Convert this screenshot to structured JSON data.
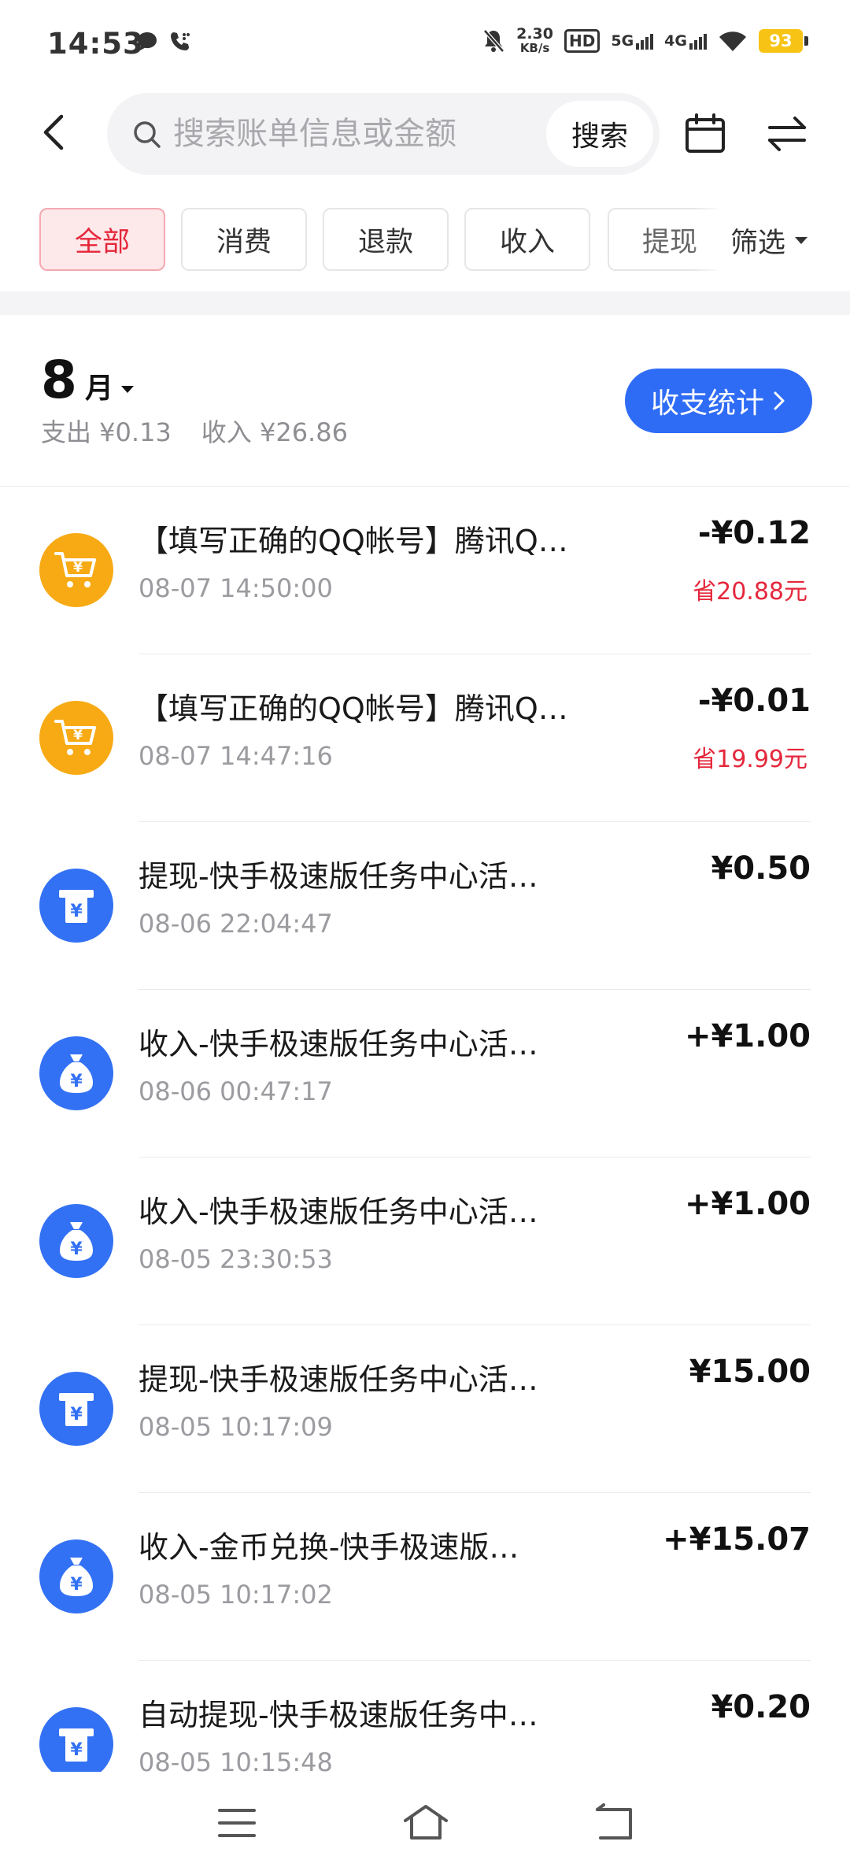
{
  "status_bar": {
    "time": "14:53",
    "speed_value": "2.30",
    "speed_unit": "KB/s",
    "hd_label": "HD",
    "net_5g": "5G",
    "net_4g": "4G",
    "battery": "93",
    "battery_color": "#f7c315"
  },
  "header": {
    "search_placeholder": "搜索账单信息或金额",
    "search_button": "搜索"
  },
  "filters": {
    "tabs": [
      {
        "label": "全部",
        "active": true
      },
      {
        "label": "消费",
        "active": false
      },
      {
        "label": "退款",
        "active": false
      },
      {
        "label": "收入",
        "active": false
      },
      {
        "label": "提现",
        "active": false
      }
    ],
    "filter_label": "筛选"
  },
  "month": {
    "number": "8",
    "unit": "月",
    "expense": "支出 ¥0.13",
    "income": "收入 ¥26.86",
    "stats_button": "收支统计"
  },
  "colors": {
    "accent_blue": "#2f6cf6",
    "accent_red": "#e5273b",
    "shop_orange": "#f7aa14",
    "icon_blue": "#3371f4"
  },
  "transactions": [
    {
      "icon": "shopping-cart-icon",
      "title": "【填写正确的QQ帐号】腾讯Q…",
      "time": "08-07 14:50:00",
      "amount": "-¥0.12",
      "saved": "省20.88元"
    },
    {
      "icon": "shopping-cart-icon",
      "title": "【填写正确的QQ帐号】腾讯Q…",
      "time": "08-07 14:47:16",
      "amount": "-¥0.01",
      "saved": "省19.99元"
    },
    {
      "icon": "withdraw-icon",
      "title": "提现-快手极速版任务中心活…",
      "time": "08-06 22:04:47",
      "amount": "¥0.50",
      "saved": ""
    },
    {
      "icon": "money-bag-icon",
      "title": "收入-快手极速版任务中心活…",
      "time": "08-06 00:47:17",
      "amount": "+¥1.00",
      "saved": ""
    },
    {
      "icon": "money-bag-icon",
      "title": "收入-快手极速版任务中心活…",
      "time": "08-05 23:30:53",
      "amount": "+¥1.00",
      "saved": ""
    },
    {
      "icon": "withdraw-icon",
      "title": "提现-快手极速版任务中心活…",
      "time": "08-05 10:17:09",
      "amount": "¥15.00",
      "saved": ""
    },
    {
      "icon": "money-bag-icon",
      "title": "收入-金币兑换-快手极速版…",
      "time": "08-05 10:17:02",
      "amount": "+¥15.07",
      "saved": ""
    },
    {
      "icon": "withdraw-icon",
      "title": "自动提现-快手极速版任务中…",
      "time": "08-05 10:15:48",
      "amount": "¥0.20",
      "saved": ""
    }
  ]
}
